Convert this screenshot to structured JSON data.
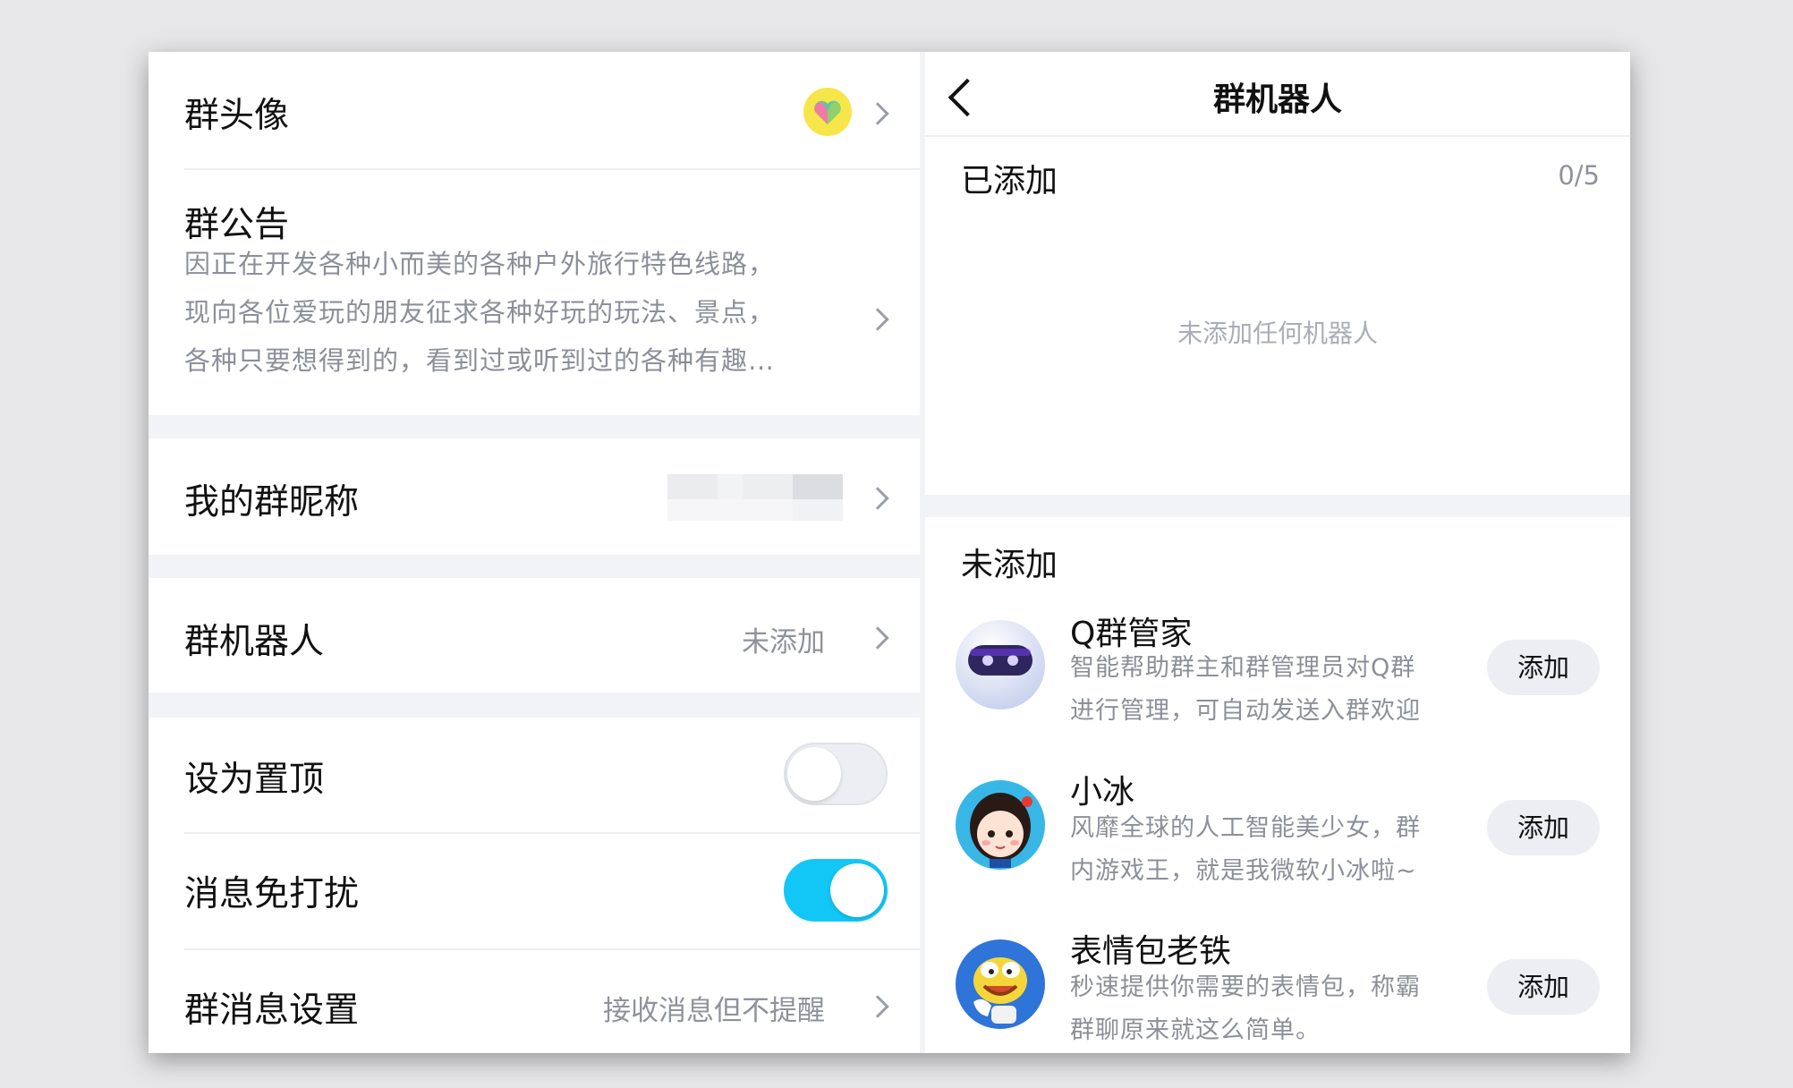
{
  "left": {
    "avatar_row": {
      "label": "群头像",
      "icon": "heart-avatar-icon"
    },
    "notice": {
      "label": "群公告",
      "lines": [
        "因正在开发各种小而美的各种户外旅行特色线路，",
        "现向各位爱玩的朋友征求各种好玩的玩法、景点，",
        "各种只要想得到的，看到过或听到过的各种有趣…"
      ]
    },
    "nickname": {
      "label": "我的群昵称",
      "value_hidden": true
    },
    "robot": {
      "label": "群机器人",
      "value": "未添加"
    },
    "pin_top": {
      "label": "设为置顶",
      "on": false
    },
    "mute": {
      "label": "消息免打扰",
      "on": true
    },
    "msg_settings": {
      "label": "群消息设置",
      "value": "接收消息但不提醒"
    }
  },
  "right": {
    "header": {
      "title": "群机器人",
      "back_icon": "back-chevron-icon"
    },
    "added": {
      "title": "已添加",
      "count": "0/5",
      "empty_text": "未添加任何机器人"
    },
    "not_added": {
      "title": "未添加",
      "bots": [
        {
          "name": "Q群管家",
          "desc_lines": [
            "智能帮助群主和群管理员对Q群",
            "进行管理，可自动发送入群欢迎"
          ],
          "button": "添加",
          "icon": "robot-avatar-icon"
        },
        {
          "name": "小冰",
          "desc_lines": [
            "风靡全球的人工智能美少女，群",
            "内游戏王，就是我微软小冰啦~"
          ],
          "button": "添加",
          "icon": "girl-avatar-icon"
        },
        {
          "name": "表情包老铁",
          "desc_lines": [
            "秒速提供你需要的表情包，称霸",
            "群聊原来就这么简单。"
          ],
          "button": "添加",
          "icon": "emoji-avatar-icon"
        }
      ]
    }
  },
  "colors": {
    "toggle_on": "#12c7f5",
    "accent_purple": "#6f3be0"
  }
}
